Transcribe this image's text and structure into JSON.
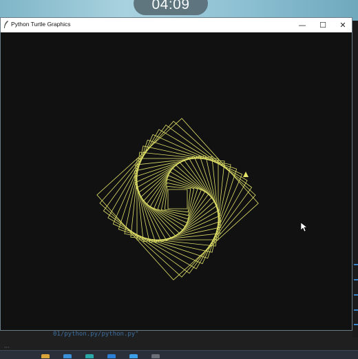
{
  "overlay": {
    "clock": "04:09"
  },
  "window": {
    "title": "Python Turtle Graphics",
    "controls": {
      "minimize": "—",
      "maximize": "☐",
      "close": "✕"
    }
  },
  "drawing": {
    "line_color": "#e3e36a",
    "canvas_color": "#111111",
    "shape": "rotating-squares-spiral",
    "square_count": 24
  },
  "background_editor": {
    "path_text": "01/python.py/python.py\""
  },
  "colors": {
    "titlebar": "#ffffff",
    "taskbar": "#2a2f3a",
    "accent": "#3b87c9"
  }
}
